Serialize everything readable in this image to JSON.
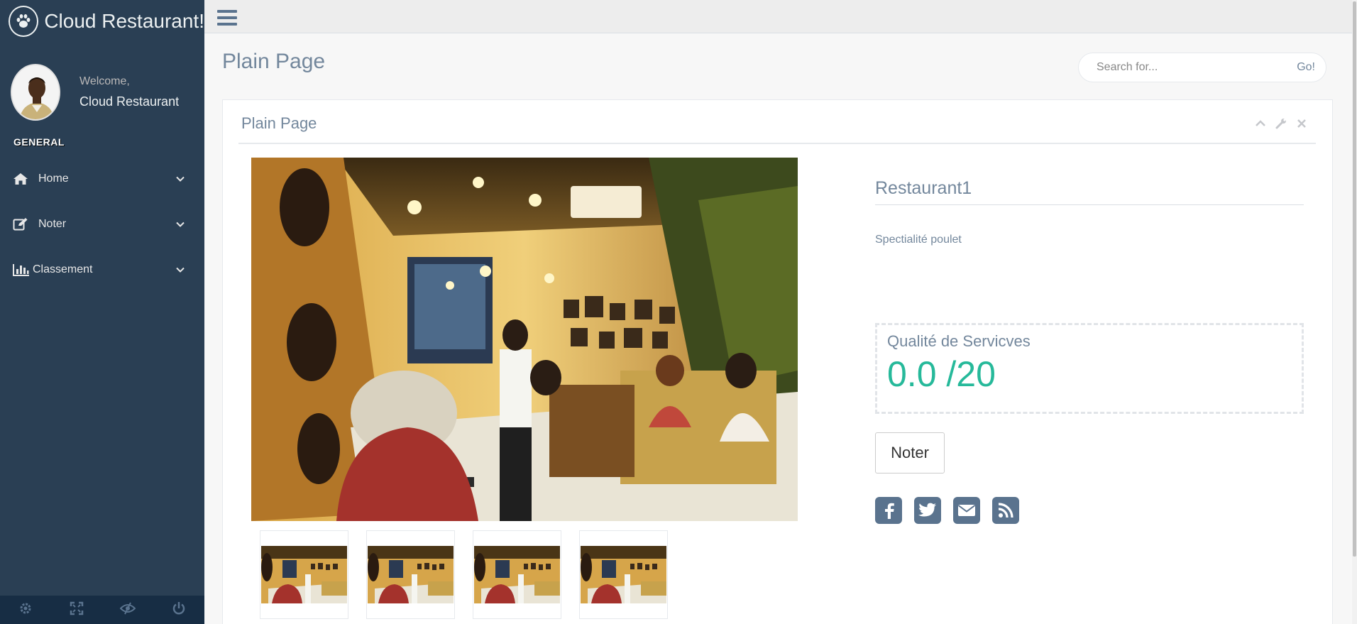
{
  "brand": {
    "title": "Cloud Restaurant!",
    "icon": "paw-icon"
  },
  "profile": {
    "welcome": "Welcome,",
    "name": "Cloud Restaurant"
  },
  "sidebar": {
    "section_title": "GENERAL",
    "items": [
      {
        "label": "Home",
        "icon": "home-icon"
      },
      {
        "label": "Noter",
        "icon": "edit-icon"
      },
      {
        "label": "Classement",
        "icon": "bar-chart-icon"
      }
    ],
    "footer": [
      "settings-icon",
      "fullscreen-icon",
      "lock-eye-icon",
      "power-icon"
    ]
  },
  "header": {
    "page_title": "Plain Page"
  },
  "search": {
    "placeholder": "Search for...",
    "go_label": "Go!"
  },
  "panel": {
    "title": "Plain Page",
    "tools": [
      "chevron-up-icon",
      "wrench-icon",
      "close-icon"
    ]
  },
  "restaurant": {
    "name": "Restaurant1",
    "specialty": "Spectialité poulet",
    "quality_label": "Qualité de Servicves",
    "quality_score": "0.0 /20",
    "rate_button": "Noter",
    "thumbnail_count": 4,
    "socials": [
      "facebook-icon",
      "twitter-icon",
      "envelope-icon",
      "rss-icon"
    ]
  },
  "colors": {
    "sidebar_bg": "#2A3F54",
    "accent_green": "#26B99A",
    "text": "#73879C"
  }
}
